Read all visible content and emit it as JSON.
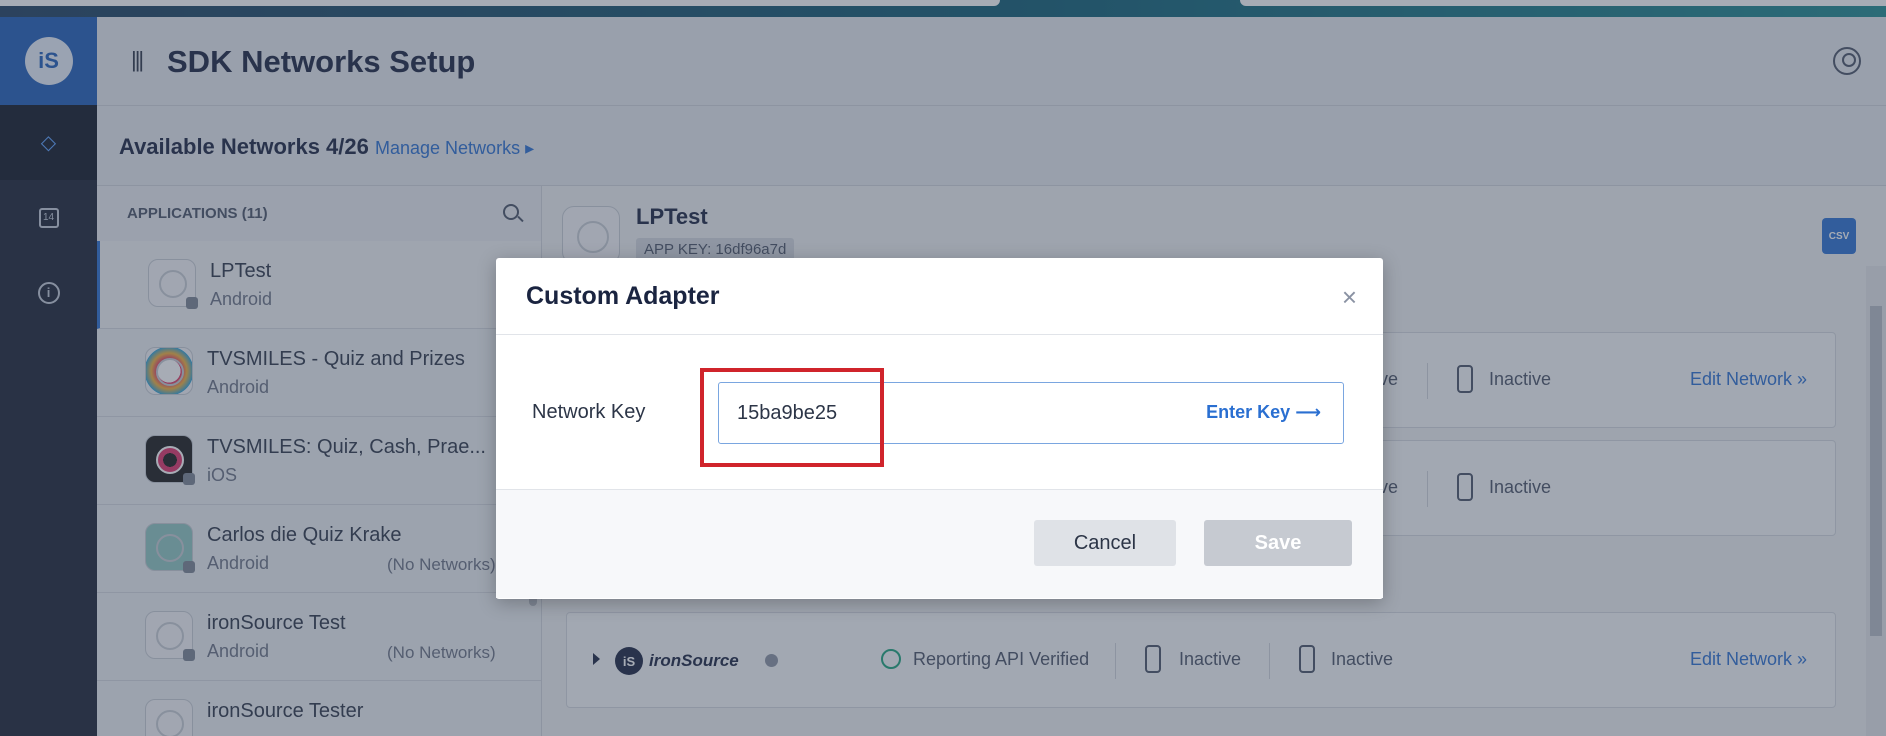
{
  "header": {
    "title": "SDK Networks Setup"
  },
  "subheader": {
    "available": "Available Networks 4/26",
    "manage_link": "Manage Networks ▸"
  },
  "applist": {
    "heading": "APPLICATIONS (11)",
    "items": [
      {
        "name": "LPTest",
        "platform": "Android",
        "status": ""
      },
      {
        "name": "TVSMILES - Quiz and Prizes",
        "platform": "Android",
        "status": ""
      },
      {
        "name": "TVSMILES: Quiz, Cash, Prae...",
        "platform": "iOS",
        "status": ""
      },
      {
        "name": "Carlos die Quiz Krake",
        "platform": "Android",
        "status": "(No Networks)"
      },
      {
        "name": "ironSource Test",
        "platform": "Android",
        "status": "(No Networks)"
      },
      {
        "name": "ironSource Tester",
        "platform": "",
        "status": ""
      }
    ]
  },
  "panel": {
    "app_title": "LPTest",
    "app_key": "APP KEY: 16df96a7d",
    "csv_label": "CSV",
    "cards": [
      {
        "col1": "ve",
        "col2": "Inactive",
        "edit": "Edit Network »"
      },
      {
        "col1": "ve",
        "col2": "Inactive",
        "edit": ""
      },
      {
        "network": "ironSource",
        "verified": "Reporting API Verified",
        "col1": "Inactive",
        "col2": "Inactive",
        "edit": "Edit Network »"
      }
    ]
  },
  "modal": {
    "title": "Custom Adapter",
    "close": "×",
    "label": "Network Key",
    "key_value": "15ba9be25",
    "enter_key": "Enter Key ⟶",
    "cancel": "Cancel",
    "save": "Save"
  },
  "colors": {
    "accent": "#2a6fd1",
    "highlight": "#d0242b",
    "rail": "#1a2233"
  }
}
